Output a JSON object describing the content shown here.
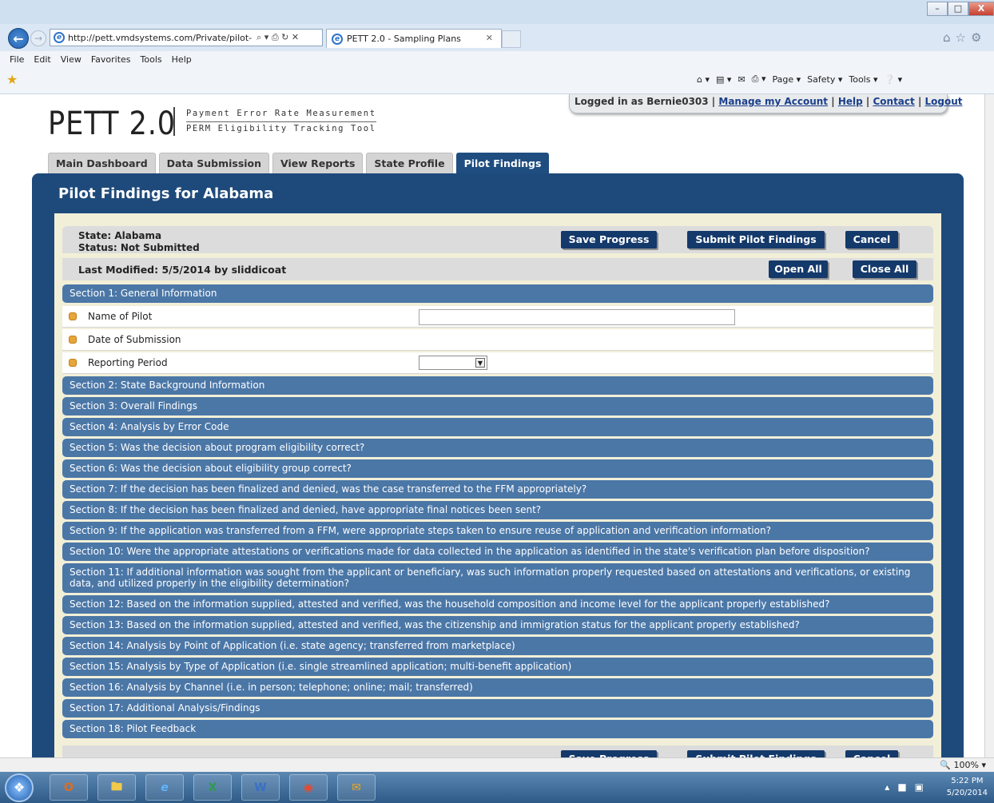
{
  "browser": {
    "url": "http://pett.vmdsystems.com/Private/pilot-",
    "address_controls": "⌕ ▾ ⎙ ↻ ✕",
    "tab_title": "PETT 2.0 - Sampling Plans",
    "menu": [
      "File",
      "Edit",
      "View",
      "Favorites",
      "Tools",
      "Help"
    ],
    "commands": [
      "Page ▾",
      "Safety ▾",
      "Tools ▾"
    ],
    "zoom": "100%",
    "window_buttons": {
      "min": "–",
      "max": "□",
      "close": "X"
    }
  },
  "app": {
    "logo": "PETT 2.0",
    "logo_line1": "Payment Error Rate Measurement",
    "logo_line2": "PERM Eligibility Tracking Tool",
    "user_prefix": "Logged in as Bernie0303 |",
    "links": {
      "account": "Manage my Account",
      "help": "Help",
      "contact": "Contact",
      "logout": "Logout"
    },
    "separator": "|",
    "tabs": [
      "Main Dashboard",
      "Data Submission",
      "View Reports",
      "State Profile",
      "Pilot Findings"
    ]
  },
  "panel": {
    "title": "Pilot Findings for Alabama",
    "state": "State: Alabama",
    "status": "Status: Not Submitted",
    "last_modified": "Last Modified: 5/5/2014 by sliddicoat",
    "buttons": {
      "save": "Save Progress",
      "submit": "Submit Pilot Findings",
      "cancel": "Cancel",
      "open_all": "Open All",
      "close_all": "Close All"
    },
    "fields": [
      "Name of Pilot",
      "Date of Submission",
      "Reporting Period"
    ],
    "reporting_period_value": "",
    "sections": [
      "Section 1: General Information",
      "Section 2: State Background Information",
      "Section 3: Overall Findings",
      "Section 4: Analysis by Error Code",
      "Section 5: Was the decision about program eligibility correct?",
      "Section 6: Was the decision about eligibility group correct?",
      "Section 7: If the decision has been finalized and denied, was the case transferred to the FFM appropriately?",
      "Section 8: If the decision has been finalized and denied, have appropriate final notices been sent?",
      "Section 9: If the application was transferred from a FFM, were appropriate steps taken to ensure reuse of application and verification information?",
      "Section 10: Were the appropriate attestations or verifications made for data collected in the application as identified in the state's verification plan before disposition?",
      "Section 11: If additional information was sought from the applicant or beneficiary, was such information properly requested based on attestations and verifications, or existing data, and utilized properly in the eligibility determination?",
      "Section 12: Based on the information supplied, attested and verified, was the household composition and income level for the applicant properly established?",
      "Section 13: Based on the information supplied, attested and verified, was the citizenship and immigration status for the applicant properly established?",
      "Section 14: Analysis by Point of Application (i.e. state agency; transferred from marketplace)",
      "Section 15: Analysis by Type of Application (i.e. single streamlined application; multi-benefit application)",
      "Section 16: Analysis by Channel (i.e. in person; telephone; online; mail; transferred)",
      "Section 17: Additional Analysis/Findings",
      "Section 18: Pilot Feedback"
    ]
  },
  "taskbar": {
    "time": "5:22 PM",
    "date": "5/20/2014",
    "apps": [
      "Outlook",
      "Explorer",
      "Internet Explorer",
      "Excel",
      "Word",
      "Chrome",
      "Outlook reminder"
    ]
  }
}
